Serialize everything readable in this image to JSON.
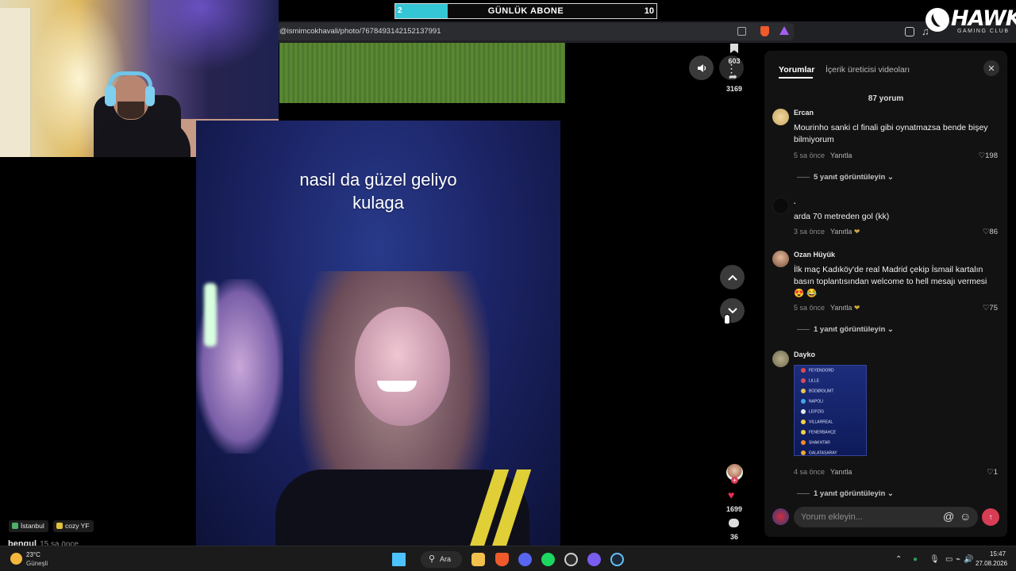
{
  "overlay": {
    "sub_goal": {
      "current": "2",
      "title": "GÜNLÜK ABONE",
      "target": "10",
      "progress_fraction": 0.2,
      "fill_color": "#35c6d6"
    },
    "logo": {
      "text": "HAWK",
      "subtitle": "GAMING CLUB"
    }
  },
  "browser": {
    "url": "@ismimcokhavali/photo/7678493142152137991"
  },
  "feed": {
    "caption_line1": "nasil da güzel geliyo",
    "caption_line2": "kulaga",
    "bookmark_count": "603",
    "share_count": "3169",
    "like_count": "1699",
    "comment_count": "36",
    "tags": [
      {
        "label": "İstanbul",
        "color": "#4fae6a"
      },
      {
        "label": "cozy YF",
        "color": "#e2c23b"
      }
    ],
    "author": "bengul",
    "author_time": "15 sa önce"
  },
  "comments_panel": {
    "tabs": [
      "Yorumlar",
      "İçerik üreticisi videoları"
    ],
    "total": "87 yorum",
    "input_placeholder": "Yorum ekleyin...",
    "reply_label": "Yanıtla",
    "comments": [
      {
        "user": "Ercan",
        "text": "Mourinho sanki cl finali gibi oynatmazsa bende bişey bilmiyorum",
        "time": "5 sa önce",
        "likes": "198",
        "more": "5 yanıt görüntüleyin"
      },
      {
        "user": ".",
        "text": "arda 70 metreden gol (kk)",
        "time": "3 sa önce",
        "likes": "86",
        "more": ""
      },
      {
        "user": "Ozan Hüyük",
        "text": "İlk maç Kadıköy'de real Madrid çekip İsmail kartalın basın toplantısından welcome to hell mesajı vermesi 😍 😂",
        "time": "5 sa önce",
        "likes": "75",
        "more": "1 yanıt görüntüleyin"
      },
      {
        "user": "Dayko",
        "text": "",
        "time": "4 sa önce",
        "likes": "1",
        "more": "1 yanıt görüntüleyin",
        "image_teams": [
          "FEYENOORD",
          "LILLE",
          "BODØ/GLIMT",
          "NAPOLI",
          "LEIPZIG",
          "VILLARREAL",
          "FENERBAHÇE",
          "SHAKHTAR",
          "GALATASARAY"
        ]
      }
    ]
  },
  "taskbar": {
    "weather_temp": "23°C",
    "weather_desc": "Güneşli",
    "search_label": "Ara",
    "time": "15:47",
    "date": "27.08.2026"
  }
}
